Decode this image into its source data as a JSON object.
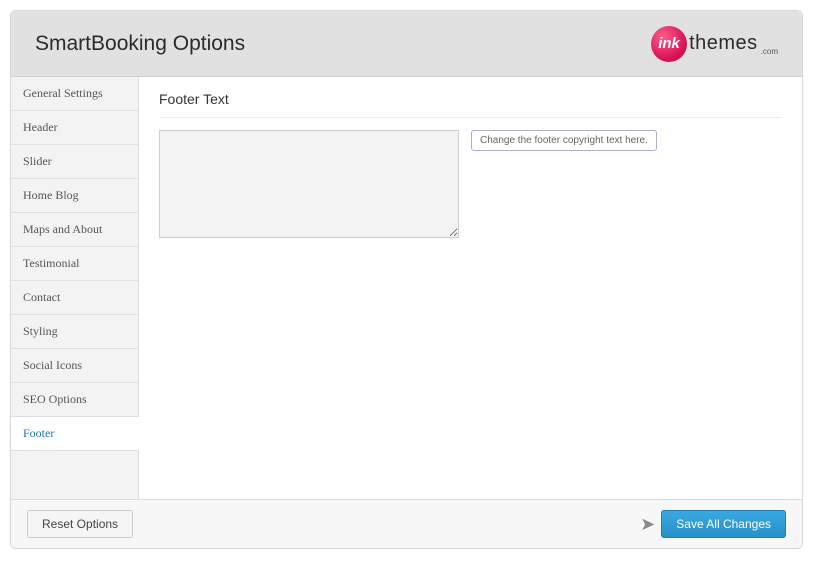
{
  "header": {
    "title": "SmartBooking Options",
    "logo": {
      "ball_text": "ink",
      "word": "themes",
      "suffix": ".com"
    }
  },
  "sidebar": {
    "items": [
      {
        "label": "General Settings",
        "active": false
      },
      {
        "label": "Header",
        "active": false
      },
      {
        "label": "Slider",
        "active": false
      },
      {
        "label": "Home Blog",
        "active": false
      },
      {
        "label": "Maps and About",
        "active": false
      },
      {
        "label": "Testimonial",
        "active": false
      },
      {
        "label": "Contact",
        "active": false
      },
      {
        "label": "Styling",
        "active": false
      },
      {
        "label": "Social Icons",
        "active": false
      },
      {
        "label": "SEO Options",
        "active": false
      },
      {
        "label": "Footer",
        "active": true
      }
    ]
  },
  "content": {
    "section_title": "Footer Text",
    "footer_text_value": "",
    "hint": "Change the footer copyright text here."
  },
  "footer_bar": {
    "reset_label": "Reset Options",
    "save_label": "Save All Changes"
  }
}
